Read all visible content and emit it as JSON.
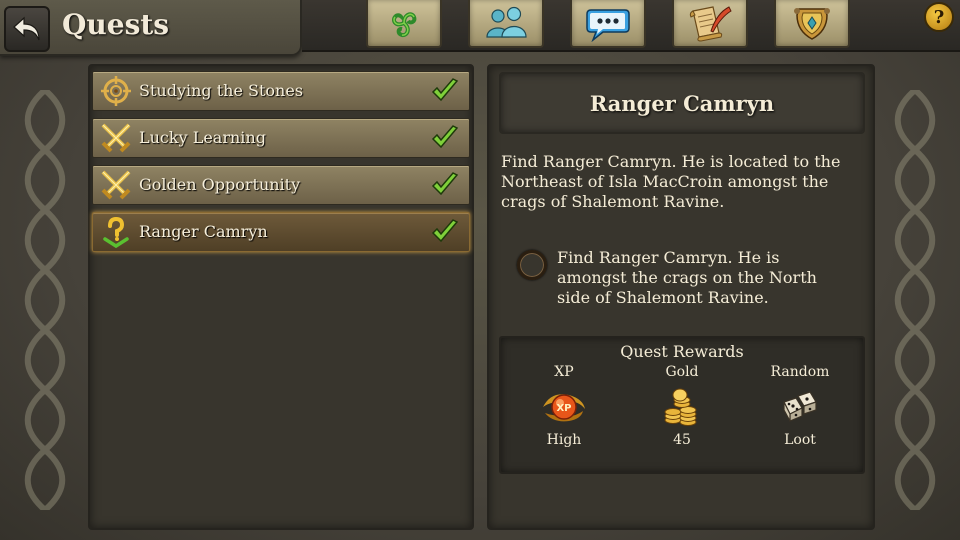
{
  "header": {
    "title": "Quests",
    "tabs": [
      {
        "icon": "triskelion-icon"
      },
      {
        "icon": "friends-icon"
      },
      {
        "icon": "chat-icon"
      },
      {
        "icon": "scroll-quill-icon"
      },
      {
        "icon": "guild-shield-icon"
      }
    ],
    "help_label": "?"
  },
  "quests": [
    {
      "label": "Studying the Stones",
      "icon": "compass-target-icon",
      "completed": true,
      "selected": false
    },
    {
      "label": "Lucky Learning",
      "icon": "crossed-swords-icon",
      "completed": true,
      "selected": false
    },
    {
      "label": "Golden Opportunity",
      "icon": "crossed-swords-icon",
      "completed": true,
      "selected": false
    },
    {
      "label": "Ranger Camryn",
      "icon": "question-mark-icon",
      "completed": true,
      "selected": true
    }
  ],
  "detail": {
    "title": "Ranger Camryn",
    "description": "Find Ranger Camryn. He is located to the Northeast of Isla MacCroin amongst the crags of Shalemont Ravine.",
    "objective": "Find Ranger Camryn. He is amongst the crags on the North side of Shalemont Ravine."
  },
  "rewards": {
    "title": "Quest Rewards",
    "items": [
      {
        "label": "XP",
        "value": "High",
        "icon": "xp-orb-icon"
      },
      {
        "label": "Gold",
        "value": "45",
        "icon": "gold-coins-icon"
      },
      {
        "label": "Random",
        "value": "Loot",
        "icon": "dice-icon"
      }
    ]
  },
  "colors": {
    "check": "#7fd03a",
    "gold": "#e8b43a",
    "selected_glow": "#c79a46"
  }
}
